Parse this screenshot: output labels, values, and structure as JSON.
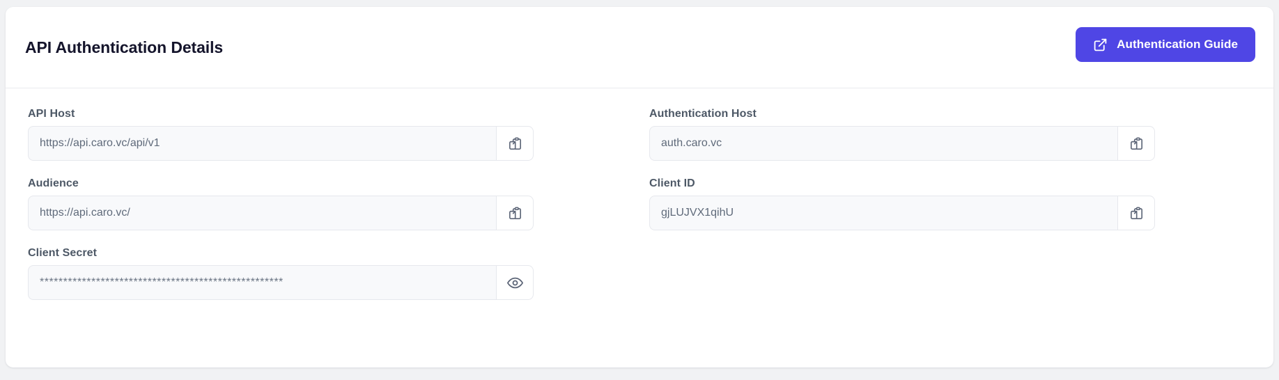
{
  "header": {
    "title": "API Authentication Details",
    "guide_button": {
      "label": "Authentication Guide",
      "icon": "external-link-icon",
      "color": "#4f46e5",
      "text_color": "#ffffff"
    }
  },
  "theme": {
    "page_background": "#f1f2f4",
    "card_background": "#ffffff",
    "input_background": "#f8f9fb",
    "input_border": "#e6e8ed",
    "label_color": "#4d5866",
    "value_color": "#5f6a7a",
    "title_color": "#14142b",
    "accent": "#4f46e5"
  },
  "fields": [
    {
      "key": "api_host",
      "label": "API Host",
      "value": "https://api.caro.vc/api/v1",
      "action_icon": "copy-icon",
      "column": "left"
    },
    {
      "key": "authentication_host",
      "label": "Authentication Host",
      "value": "auth.caro.vc",
      "action_icon": "copy-icon",
      "column": "right"
    },
    {
      "key": "audience",
      "label": "Audience",
      "value": "https://api.caro.vc/",
      "action_icon": "copy-icon",
      "column": "left"
    },
    {
      "key": "client_id",
      "label": "Client ID",
      "value": "gjLUJVX1qihU",
      "action_icon": "copy-icon",
      "column": "right"
    },
    {
      "key": "client_secret",
      "label": "Client Secret",
      "value": "****************************************************",
      "action_icon": "eye-icon",
      "column": "left"
    }
  ]
}
